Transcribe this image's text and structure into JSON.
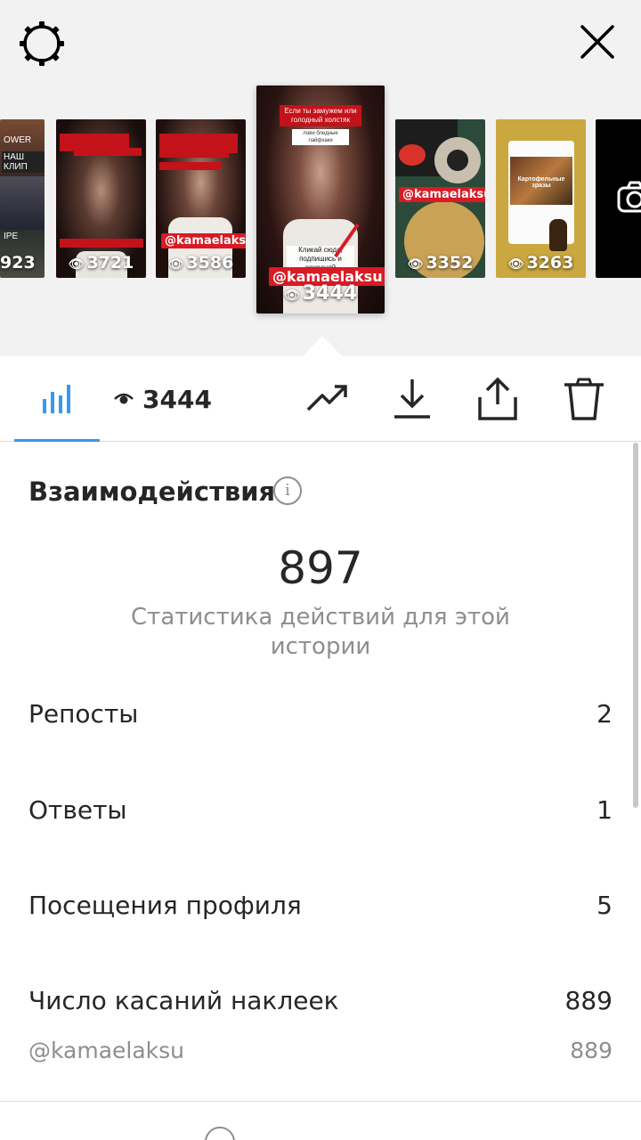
{
  "header": {
    "settings_icon": "gear-icon",
    "close_icon": "close-icon"
  },
  "stories": [
    {
      "views": "923",
      "caption": "НАШ КЛИП",
      "caption2": "OWER",
      "caption3": "IPE"
    },
    {
      "views": "3721"
    },
    {
      "views": "3586",
      "handle": "@kamaelaksu"
    },
    {
      "views": "3444",
      "handle": "@kamaelaksu",
      "caption": "Если ты замужем или голодный холстяк",
      "caption_small": "лови бледные лайфхаки",
      "cta": "Кликай сюда, подпишись и сохраняй"
    },
    {
      "views": "3352",
      "handle": "@kamaelaksu"
    },
    {
      "views": "3263",
      "caption": "Картофельные зразы"
    },
    {
      "icon": "camera-icon"
    }
  ],
  "toolbar": {
    "tab_icon": "bar-chart-icon",
    "views": "3444",
    "actions": [
      "trending-icon",
      "download-icon",
      "share-icon",
      "trash-icon"
    ]
  },
  "insights": {
    "title": "Взаимодействия",
    "total": "897",
    "subtitle": "Статистика действий для этой истории",
    "rows": [
      {
        "label": "Репосты",
        "value": "2"
      },
      {
        "label": "Ответы",
        "value": "1"
      },
      {
        "label": "Посещения профиля",
        "value": "5"
      },
      {
        "label": "Число касаний наклеек",
        "value": "889"
      }
    ],
    "sticker": {
      "label": "@kamaelaksu",
      "value": "889"
    }
  },
  "colors": {
    "accent": "#3897f0",
    "handle_red": "#d81b25",
    "text": "#262626",
    "secondary": "#8e8e8e"
  }
}
